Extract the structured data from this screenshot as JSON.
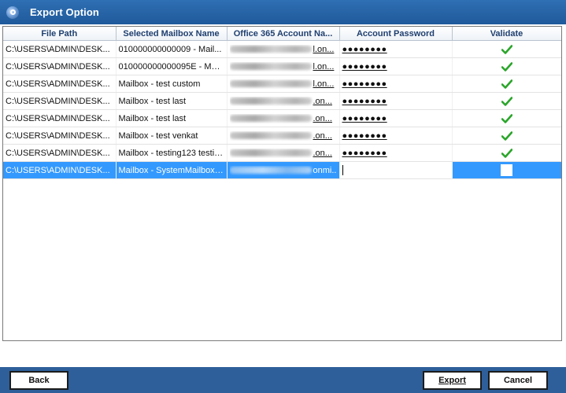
{
  "window": {
    "title": "Export Option",
    "title_icon": "globe-icon"
  },
  "grid": {
    "columns": [
      "File Path",
      "Selected Mailbox Name",
      "Office 365 Account Na...",
      "Account Password",
      "Validate"
    ],
    "rows": [
      {
        "file_path": "C:\\USERS\\ADMIN\\DESK...",
        "mailbox": "010000000000009 - Mail...",
        "account_suffix": "l.on...",
        "password": "●●●●●●●●",
        "validated": true
      },
      {
        "file_path": "C:\\USERS\\ADMIN\\DESK...",
        "mailbox": "010000000000095E - Mail...",
        "account_suffix": "l.on...",
        "password": "●●●●●●●●",
        "validated": true
      },
      {
        "file_path": "C:\\USERS\\ADMIN\\DESK...",
        "mailbox": "Mailbox - test custom",
        "account_suffix": "l.on...",
        "password": "●●●●●●●●",
        "validated": true
      },
      {
        "file_path": "C:\\USERS\\ADMIN\\DESK...",
        "mailbox": "Mailbox - test last",
        "account_suffix": ".on...",
        "password": "●●●●●●●●",
        "validated": true
      },
      {
        "file_path": "C:\\USERS\\ADMIN\\DESK...",
        "mailbox": "Mailbox - test last",
        "account_suffix": ".on...",
        "password": "●●●●●●●●",
        "validated": true
      },
      {
        "file_path": "C:\\USERS\\ADMIN\\DESK...",
        "mailbox": "Mailbox - test venkat",
        "account_suffix": ".on...",
        "password": "●●●●●●●●",
        "validated": true
      },
      {
        "file_path": "C:\\USERS\\ADMIN\\DESK...",
        "mailbox": "Mailbox - testing123 testin...",
        "account_suffix": ".on...",
        "password": "●●●●●●●●",
        "validated": true
      },
      {
        "file_path": "C:\\USERS\\ADMIN\\DESK...",
        "mailbox": "Mailbox - SystemMailbox{8...",
        "account_suffix": "onmi...",
        "password": "",
        "validated": false,
        "selected": true
      }
    ]
  },
  "buttons": {
    "back": "Back",
    "export": "Export",
    "cancel": "Cancel"
  },
  "colors": {
    "titlebar": "#2f6fb3",
    "footer": "#2e5f9a",
    "selection": "#3399ff",
    "check": "#2aa52a",
    "header_text": "#1f3f6f"
  },
  "icons": {
    "validated": "check-icon",
    "not_validated": "empty-checkbox-icon"
  }
}
